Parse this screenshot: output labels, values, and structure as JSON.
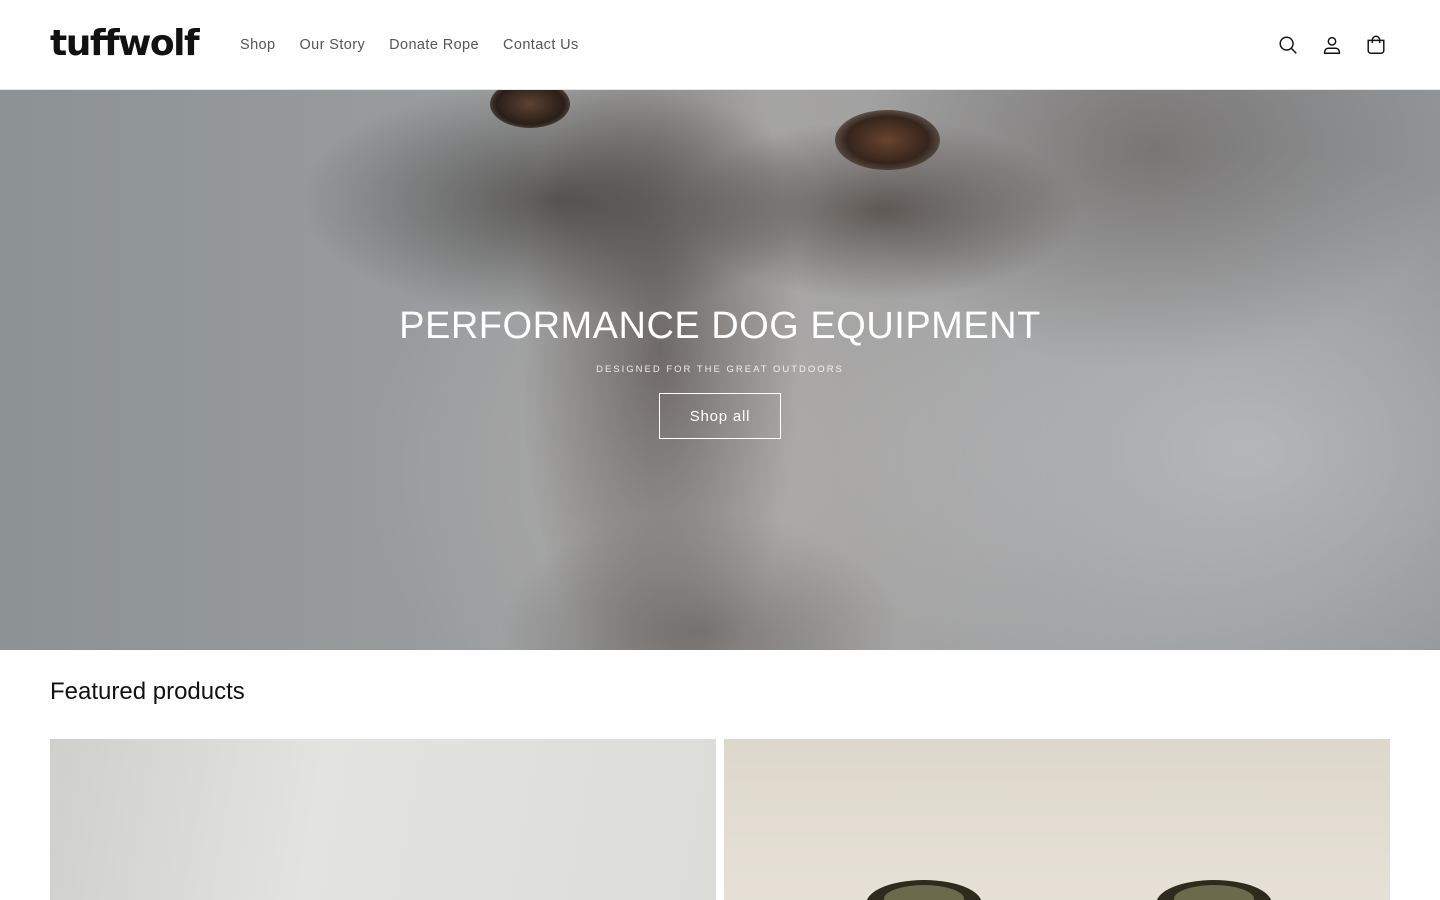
{
  "brand": {
    "logo_text": "tuffwolf"
  },
  "nav": {
    "items": [
      {
        "label": "Shop"
      },
      {
        "label": "Our Story"
      },
      {
        "label": "Donate Rope"
      },
      {
        "label": "Contact Us"
      }
    ]
  },
  "header_icons": [
    "search-icon",
    "account-icon",
    "cart-icon"
  ],
  "hero": {
    "title": "PERFORMANCE DOG EQUIPMENT",
    "subtitle": "DESIGNED FOR THE GREAT OUTDOORS",
    "button_label": "Shop all"
  },
  "featured": {
    "title": "Featured products"
  },
  "colors": {
    "text": "#121212",
    "nav_text": "#555555",
    "hero_text": "#ffffff"
  }
}
